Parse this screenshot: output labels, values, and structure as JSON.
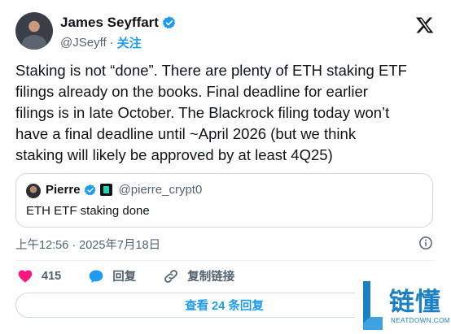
{
  "author": {
    "name": "James Seyffart",
    "handle": "@JSeyff",
    "separator": "·",
    "follow_label": "关注"
  },
  "tweet": {
    "text": "Staking is not “done”. There are plenty of ETH staking ETF\nfilings already on the books. Final deadline for earlier\nfilings is in late October. The Blackrock filing today won’t\nhave a final deadline until ~April 2026 (but we think\nstaking will likely be approved by at least 4Q25)"
  },
  "quote": {
    "name": "Pierre",
    "handle": "@pierre_crypt0",
    "text": "ETH ETF staking done"
  },
  "timestamp": "上午12:56 · 2025年7月18日",
  "actions": {
    "like_count": "415",
    "reply_label": "回复",
    "copy_link_label": "复制链接"
  },
  "replies_button_label": "查看 24 条回复",
  "watermark": {
    "brand": "链懂",
    "site": "NEATDOWN.COM"
  },
  "colors": {
    "accent": "#1d9bf0",
    "like": "#f91880",
    "text": "#0f1419",
    "muted": "#536471"
  },
  "icons": [
    "verified-badge-icon",
    "x-logo-icon",
    "info-icon",
    "heart-icon",
    "reply-bubble-icon",
    "link-icon"
  ]
}
